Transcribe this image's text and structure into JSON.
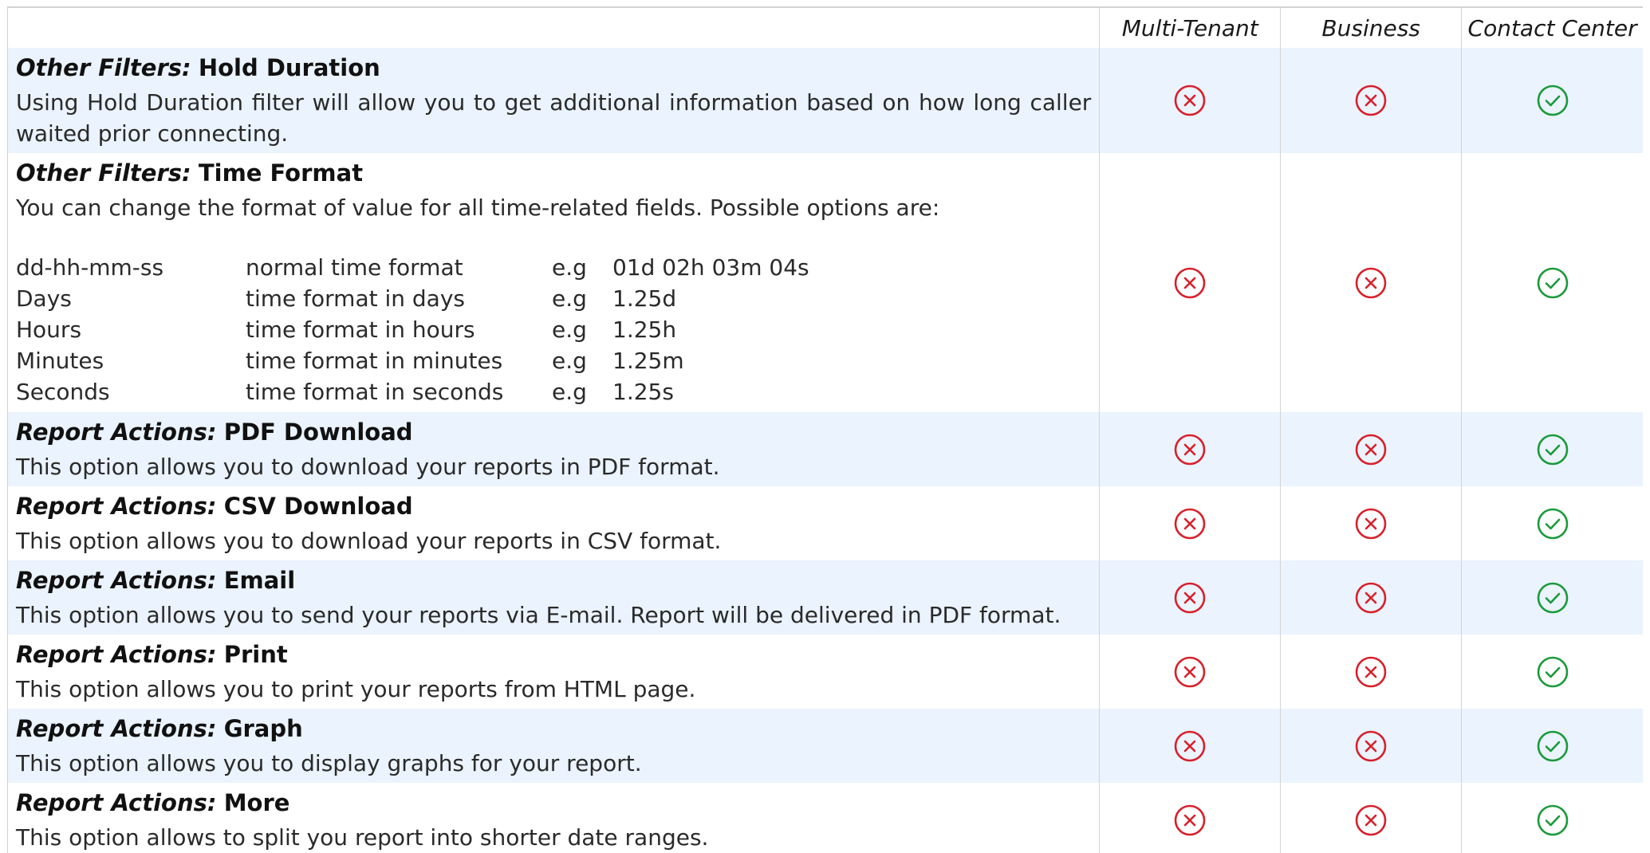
{
  "header": {
    "columns": [
      "Multi-Tenant",
      "Business",
      "Contact Center"
    ]
  },
  "colors": {
    "shaded_row": "#eaf3fe",
    "unavailable": "#d8202b",
    "available": "#1a9a3a"
  },
  "rows": [
    {
      "prefix": "Other Filters:",
      "name": "Hold Duration",
      "description": "Using Hold Duration filter will allow you to get additional information based on how long caller waited prior connecting.",
      "availability": [
        "x-circle-icon",
        "x-circle-icon",
        "check-circle-icon"
      ]
    },
    {
      "prefix": "Other Filters:",
      "name": "Time Format",
      "description": "You can change the format of value for all time-related fields. Possible options are:",
      "formats": [
        {
          "format": "dd-hh-mm-ss",
          "meaning": "normal time format",
          "eg": "e.g",
          "example": "01d 02h 03m 04s"
        },
        {
          "format": "Days",
          "meaning": "time format in days",
          "eg": "e.g",
          "example": "1.25d"
        },
        {
          "format": "Hours",
          "meaning": "time format in hours",
          "eg": "e.g",
          "example": "1.25h"
        },
        {
          "format": "Minutes",
          "meaning": "time format in minutes",
          "eg": "e.g",
          "example": "1.25m"
        },
        {
          "format": "Seconds",
          "meaning": "time format in seconds",
          "eg": "e.g",
          "example": "1.25s"
        }
      ],
      "availability": [
        "x-circle-icon",
        "x-circle-icon",
        "check-circle-icon"
      ]
    },
    {
      "prefix": "Report Actions:",
      "name": "PDF Download",
      "description": "This option allows you to download your reports in PDF format.",
      "availability": [
        "x-circle-icon",
        "x-circle-icon",
        "check-circle-icon"
      ]
    },
    {
      "prefix": "Report Actions:",
      "name": "CSV Download",
      "description": "This option allows you to download your reports in CSV format.",
      "availability": [
        "x-circle-icon",
        "x-circle-icon",
        "check-circle-icon"
      ]
    },
    {
      "prefix": "Report Actions:",
      "name": "Email",
      "description": "This option allows you to send your reports via E-mail. Report will be delivered in PDF format.",
      "availability": [
        "x-circle-icon",
        "x-circle-icon",
        "check-circle-icon"
      ]
    },
    {
      "prefix": "Report Actions:",
      "name": "Print",
      "description": "This option allows you to print your reports from HTML page.",
      "availability": [
        "x-circle-icon",
        "x-circle-icon",
        "check-circle-icon"
      ]
    },
    {
      "prefix": "Report Actions:",
      "name": "Graph",
      "description": "This option allows you to display graphs for your report.",
      "availability": [
        "x-circle-icon",
        "x-circle-icon",
        "check-circle-icon"
      ]
    },
    {
      "prefix": "Report Actions:",
      "name": "More",
      "description": "This option allows to split you report into shorter date ranges.",
      "availability": [
        "x-circle-icon",
        "x-circle-icon",
        "check-circle-icon"
      ]
    }
  ]
}
